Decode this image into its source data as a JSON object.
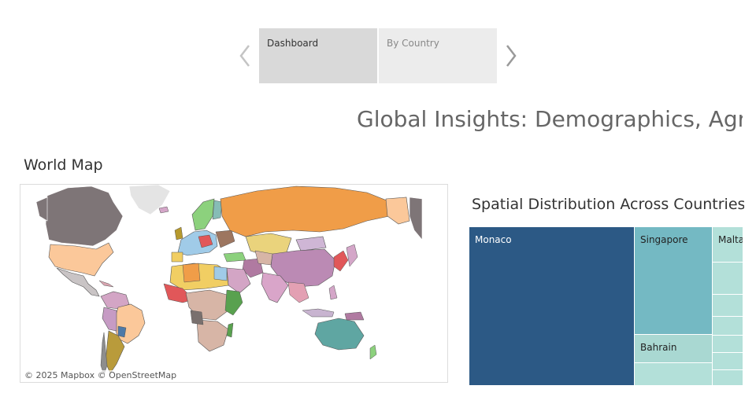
{
  "tabs": [
    {
      "label": "Dashboard",
      "active": true
    },
    {
      "label": "By Country",
      "active": false
    }
  ],
  "dashboard_title": "Global Insights: Demographics, Agriculture",
  "map": {
    "title": "World Map",
    "attribution_mapbox": "© 2025 Mapbox",
    "attribution_osm": "© OpenStreetMap"
  },
  "treemap": {
    "title": "Spatial Distribution Across Countries",
    "cells": [
      {
        "label": "Monaco",
        "color": "#2c5985"
      },
      {
        "label": "Singapore",
        "color": "#74b9c3"
      },
      {
        "label": "Bahrain",
        "color": "#a9d8d2"
      },
      {
        "label": "Malta",
        "color": "#b3e0d9"
      }
    ]
  },
  "colors": {
    "tab_active": "#d9d9d9",
    "tab_inactive": "#ececec",
    "title_text": "#666666"
  }
}
